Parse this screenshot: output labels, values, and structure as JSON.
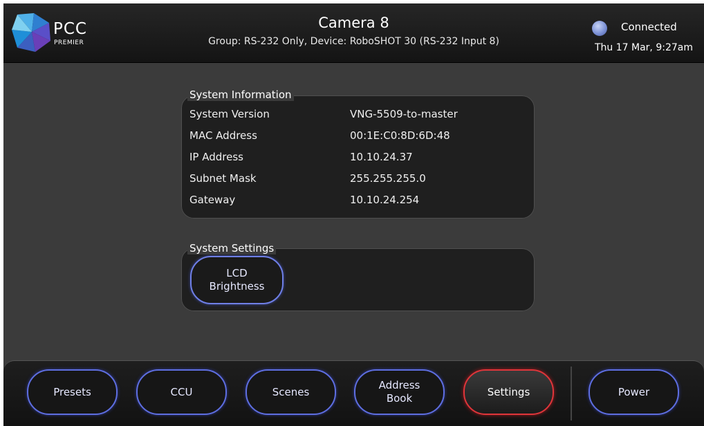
{
  "header": {
    "logo_text": "PCC",
    "logo_subtext": "PREMIER",
    "title": "Camera 8",
    "subtitle": "Group: RS-232 Only,  Device: RoboSHOT 30 (RS-232 Input 8)",
    "status": "Connected",
    "status_color": "#7d92d6",
    "datetime": "Thu 17 Mar, 9:27am"
  },
  "system_information": {
    "title": "System Information",
    "rows": [
      {
        "label": "System Version",
        "value": "VNG-5509-to-master"
      },
      {
        "label": "MAC Address",
        "value": "00:1E:C0:8D:6D:48"
      },
      {
        "label": "IP Address",
        "value": "10.10.24.37"
      },
      {
        "label": "Subnet Mask",
        "value": "255.255.255.0"
      },
      {
        "label": "Gateway",
        "value": "10.10.24.254"
      }
    ]
  },
  "system_settings": {
    "title": "System Settings",
    "lcd_brightness_label": "LCD\nBrightness"
  },
  "nav": {
    "items": [
      {
        "label": "Presets",
        "active": false
      },
      {
        "label": "CCU",
        "active": false
      },
      {
        "label": "Scenes",
        "active": false
      },
      {
        "label": "Address\nBook",
        "active": false
      },
      {
        "label": "Settings",
        "active": true
      },
      {
        "label": "Power",
        "active": false
      }
    ],
    "accent_color": "#5e6ee0",
    "active_color": "#e0353a"
  }
}
